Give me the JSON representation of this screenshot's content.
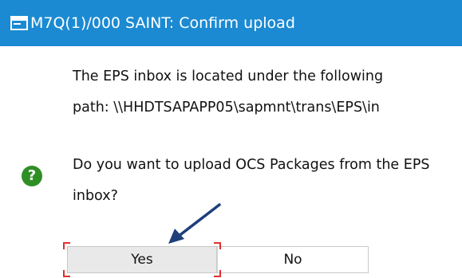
{
  "dialog": {
    "title": "M7Q(1)/000 SAINT: Confirm upload",
    "title_icon": "dialog-window-icon",
    "message_line1": "The EPS inbox is located under the following",
    "message_line2": "path: \\\\HHDTSAPAPP05\\sapmnt\\trans\\EPS\\in",
    "question_line1": "Do you want to upload OCS Packages from the EPS",
    "question_line2": "inbox?",
    "question_icon": "question-icon",
    "question_icon_glyph": "?",
    "buttons": {
      "yes_label": "Yes",
      "no_label": "No"
    }
  },
  "colors": {
    "titlebar": "#1b8ad2",
    "question_icon": "#2f8f25",
    "focus_marker": "#e03030",
    "annotation_arrow": "#1f3f7a"
  }
}
